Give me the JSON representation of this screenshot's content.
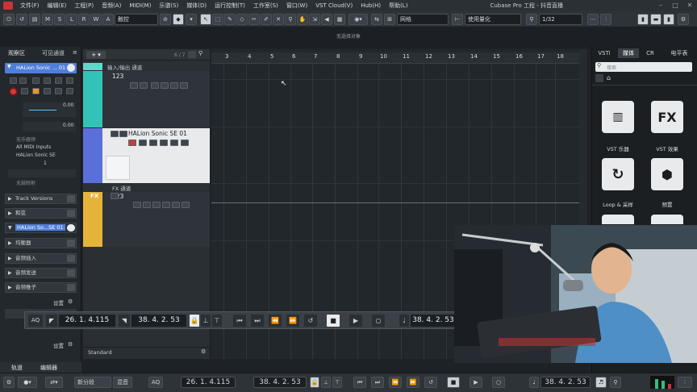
{
  "menu": {
    "items": [
      "文件(F)",
      "编辑(E)",
      "工程(P)",
      "音频(A)",
      "MIDI(M)",
      "乐谱(S)",
      "媒体(D)",
      "运行控制(T)",
      "工作室(S)",
      "窗口(W)",
      "VST Cloud(V)",
      "Hub(H)",
      "帮助(L)"
    ],
    "window_title": "Cubase Pro 工程 - 抖音直播"
  },
  "toolbar": {
    "m": "M",
    "s": "S",
    "l": "L",
    "r": "R",
    "w": "W",
    "a": "A",
    "mode": "触控",
    "snap": "网格",
    "quantize": "使用量化",
    "quant_value": "1/32"
  },
  "status": {
    "text": "无选择对象"
  },
  "left": {
    "tab_inspector": "观察区",
    "tab_visibility": "可见通道",
    "track_name": "HALion Sonic ... 01",
    "vol": "0.00",
    "pan": "0.00",
    "no_bank": "无乐器预",
    "input": "All MIDI Inputs",
    "output": "HALion Sonic SE",
    "vel": "1",
    "no_drum": "无鼓映射",
    "sec_versions": "Track Versions",
    "sec_chord": "和弦",
    "sec_halion": "HALion So...SE 01",
    "sec_eq": "均衡器",
    "sec_inserts": "音频插入",
    "sec_sends": "音频发送",
    "sec_sends2": "音频推子",
    "settings": "设置",
    "settings2": "设置",
    "tab_track": "轨道",
    "tab_editor": "编辑器"
  },
  "tracks": {
    "count": "6 / 7",
    "t1_folder": "输入/输出 通道",
    "t1_name": "123",
    "t2_name": "HALion Sonic SE 01",
    "t3_folder": "FX 通道",
    "t3_name": "123",
    "t3_fx": "FX",
    "footer": "Standard"
  },
  "ruler": {
    "bars": [
      "3",
      "4",
      "5",
      "6",
      "7",
      "8",
      "9",
      "10",
      "11",
      "12",
      "13",
      "14",
      "15",
      "16",
      "17",
      "18"
    ]
  },
  "right": {
    "tab_vsti": "VSTi",
    "tab_media": "媒体",
    "tab_cr": "CR",
    "tab_meter": "电平表",
    "search_placeholder": "搜索",
    "tiles": [
      {
        "icon": "piano-icon",
        "label": "VST 乐器"
      },
      {
        "icon": "fx-icon",
        "label": "VST 效果"
      },
      {
        "icon": "loop-icon",
        "label": "Loop & 采样"
      },
      {
        "icon": "hexagon-icon",
        "label": "预置"
      }
    ]
  },
  "transport": {
    "aq": "AQ",
    "left_locator": "26. 1. 4.115",
    "right_locator": "38. 4. 2. 53",
    "position": "38. 4. 2. 53"
  },
  "bottom": {
    "segment": "新分段",
    "mix": "混音",
    "aq": "AQ",
    "left_locator": "26. 1. 4.115",
    "right_locator": "38. 4. 2. 53",
    "position": "38. 4. 2. 53"
  }
}
